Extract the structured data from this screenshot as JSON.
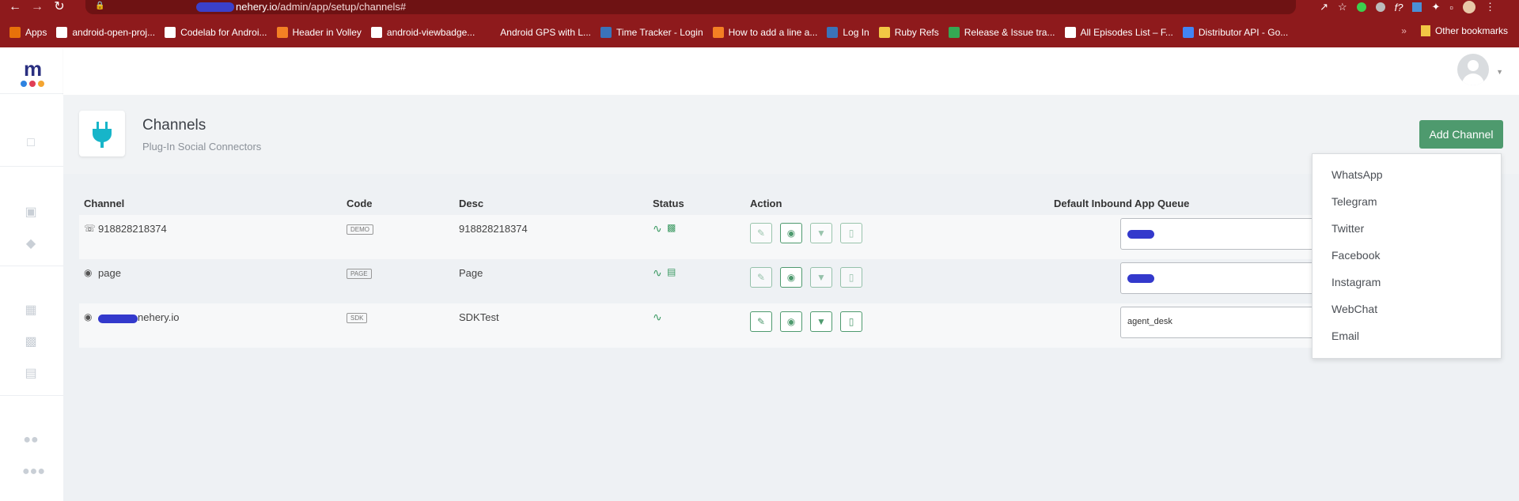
{
  "browser": {
    "url_prefix": "",
    "url_domain": "nehery.io",
    "url_path": "/admin/app/setup/channels#",
    "bookmarks": [
      {
        "label": "Apps",
        "color": "#e8710a"
      },
      {
        "label": "android-open-proj...",
        "color": "#ffffff"
      },
      {
        "label": "Codelab for Androi...",
        "color": "#ffffff"
      },
      {
        "label": "Header in Volley",
        "color": "#f48024"
      },
      {
        "label": "android-viewbadge...",
        "color": "#ffffff"
      },
      {
        "label": "Android GPS with L...",
        "color": "#8e1a1c"
      },
      {
        "label": "Time Tracker - Login",
        "color": "#3b73b9"
      },
      {
        "label": "How to add a line a...",
        "color": "#f48024"
      },
      {
        "label": "Log In",
        "color": "#3b73b9"
      },
      {
        "label": "Ruby Refs",
        "color": "#f2c744"
      },
      {
        "label": "Release & Issue tra...",
        "color": "#34a853"
      },
      {
        "label": "All Episodes List – F...",
        "color": "#ffffff"
      },
      {
        "label": "Distributor API - Go...",
        "color": "#4285f4"
      }
    ],
    "other_bookmarks": "Other bookmarks"
  },
  "page": {
    "title": "Channels",
    "subtitle": "Plug-In Social Connectors",
    "add_button": "Add Channel"
  },
  "table": {
    "headers": [
      "Channel",
      "Code",
      "Desc",
      "Status",
      "Action",
      "Default Inbound App Queue"
    ],
    "rows": [
      {
        "channel": "918828218374",
        "code": "DEMO",
        "desc": "918828218374",
        "queue": ""
      },
      {
        "channel": "page",
        "code": "PAGE",
        "desc": "Page",
        "queue": ""
      },
      {
        "channel": "nehery.io",
        "code": "SDK",
        "desc": "SDKTest",
        "queue": "agent_desk"
      }
    ]
  },
  "dropdown": {
    "items": [
      "WhatsApp",
      "Telegram",
      "Twitter",
      "Facebook",
      "Instagram",
      "WebChat",
      "Email"
    ]
  },
  "colors": {
    "browser_bar": "#8e1a1c",
    "accent_green": "#4e9a6e",
    "icon_teal": "#17b5c9"
  }
}
